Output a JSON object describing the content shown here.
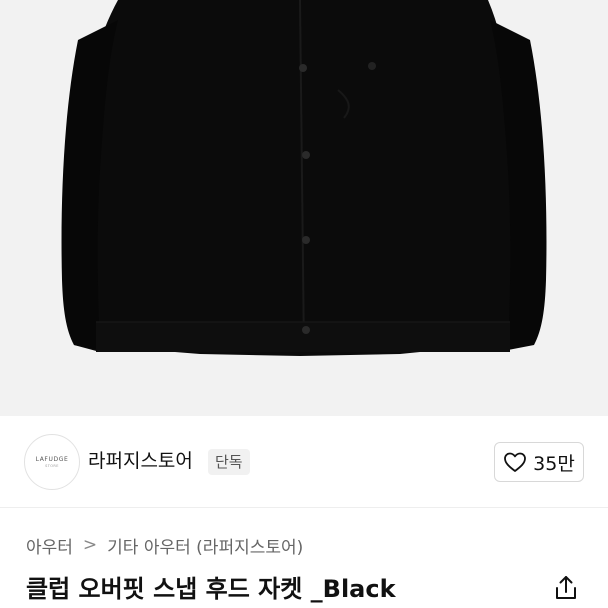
{
  "colors": {
    "hero_background": "#f2f2f2",
    "jacket": "#0a0a0a",
    "badge_background": "#f1f1f1"
  },
  "hero": {
    "image": "black-snap-hood-jacket-photo"
  },
  "seller": {
    "avatar_logo": "LAFUDGE",
    "avatar_logo_sub": "STORE",
    "name": "라퍼지스토어",
    "badge": "단독"
  },
  "like": {
    "icon": "heart-icon",
    "count": "35만"
  },
  "breadcrumb": {
    "items": [
      "아우터",
      "기타 아우터 (라퍼지스토어)"
    ],
    "separator": ">"
  },
  "product": {
    "title": "클럽 오버핏 스냅 후드 자켓 _Black",
    "share_icon": "share-icon"
  }
}
